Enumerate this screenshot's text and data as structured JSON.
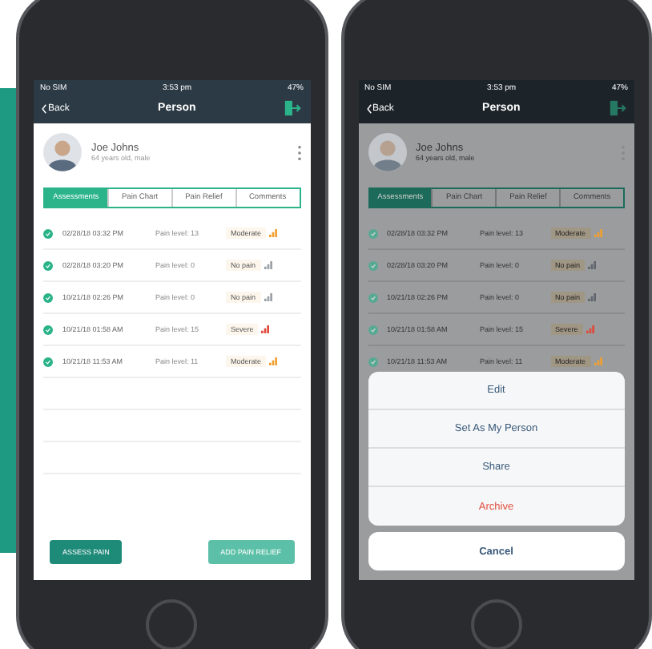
{
  "phones": [
    {
      "dimmed": false,
      "status": {
        "carrier": "No SIM",
        "time": "3:53 pm",
        "battery": "47%"
      },
      "nav": {
        "back": "Back",
        "title": "Person"
      },
      "person": {
        "name": "Joe Johns",
        "details": "64 years old, male"
      },
      "tabs": [
        {
          "label": "Assessments",
          "selected": true
        },
        {
          "label": "Pain Chart",
          "selected": false
        },
        {
          "label": "Pain Relief",
          "selected": false
        },
        {
          "label": "Comments",
          "selected": false
        }
      ],
      "rows": [
        {
          "date": "02/28/18 03:32 PM",
          "level": "Pain level: 13",
          "severity": "Moderate",
          "color": "#f0a030"
        },
        {
          "date": "02/28/18 03:20 PM",
          "level": "Pain level: 0",
          "severity": "No pain",
          "color": "#9aa0a6"
        },
        {
          "date": "10/21/18 02:26 PM",
          "level": "Pain level: 0",
          "severity": "No pain",
          "color": "#9aa0a6"
        },
        {
          "date": "10/21/18 01:58 AM",
          "level": "Pain level: 15",
          "severity": "Severe",
          "color": "#e04a3a"
        },
        {
          "date": "10/21/18 11:53 AM",
          "level": "Pain level: 11",
          "severity": "Moderate",
          "color": "#f0a030"
        }
      ],
      "buttons": [
        "ASSESS PAIN",
        "ADD PAIN RELIEF"
      ]
    },
    {
      "dimmed": true,
      "status": {
        "carrier": "No SIM",
        "time": "3:53 pm",
        "battery": "47%"
      },
      "nav": {
        "back": "Back",
        "title": "Person"
      },
      "person": {
        "name": "Joe Johns",
        "details": "64 years old, male"
      },
      "tabs": [
        {
          "label": "Assessments",
          "selected": true
        },
        {
          "label": "Pain Chart",
          "selected": false
        },
        {
          "label": "Pain Relief",
          "selected": false
        },
        {
          "label": "Comments",
          "selected": false
        }
      ],
      "rows": [
        {
          "date": "02/28/18 03:32 PM",
          "level": "Pain level: 13",
          "severity": "Moderate",
          "color": "#f0a030"
        },
        {
          "date": "02/28/18 03:20 PM",
          "level": "Pain level: 0",
          "severity": "No pain",
          "color": "#5f656c"
        },
        {
          "date": "10/21/18 02:26 PM",
          "level": "Pain level: 0",
          "severity": "No pain",
          "color": "#5f656c"
        },
        {
          "date": "10/21/18 01:58 AM",
          "level": "Pain level: 15",
          "severity": "Severe",
          "color": "#e04a3a"
        },
        {
          "date": "10/21/18 11:53 AM",
          "level": "Pain level: 11",
          "severity": "Moderate",
          "color": "#f0a030"
        }
      ],
      "action_sheet": {
        "items": [
          {
            "label": "Edit",
            "kind": "normal"
          },
          {
            "label": "Set As My Person",
            "kind": "normal"
          },
          {
            "label": "Share",
            "kind": "normal"
          },
          {
            "label": "Archive",
            "kind": "destructive"
          }
        ],
        "cancel": "Cancel"
      }
    }
  ]
}
